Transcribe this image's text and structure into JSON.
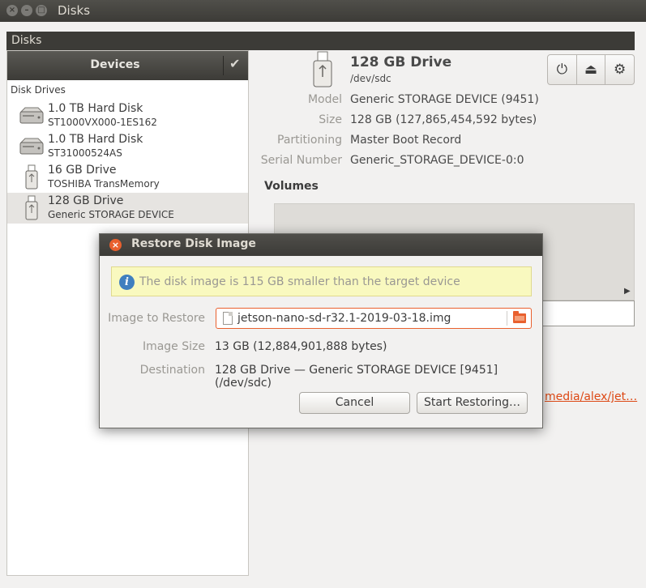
{
  "window": {
    "title": "Disks"
  },
  "appbar": {
    "title": "Disks"
  },
  "sidebar": {
    "header": "Devices",
    "section": "Disk Drives",
    "items": [
      {
        "name": "1.0 TB Hard Disk",
        "sub": "ST1000VX000-1ES162",
        "icon": "hard-disk-icon"
      },
      {
        "name": "1.0 TB Hard Disk",
        "sub": "ST31000524AS",
        "icon": "hard-disk-icon"
      },
      {
        "name": "16 GB Drive",
        "sub": "TOSHIBA TransMemory",
        "icon": "usb-drive-icon"
      },
      {
        "name": "128 GB Drive",
        "sub": "Generic STORAGE DEVICE",
        "icon": "usb-drive-icon",
        "selected": true
      }
    ]
  },
  "detail": {
    "name": "128 GB Drive",
    "path": "/dev/sdc",
    "props": [
      {
        "label": "Model",
        "value": "Generic STORAGE DEVICE (9451)"
      },
      {
        "label": "Size",
        "value": "128 GB (127,865,454,592 bytes)"
      },
      {
        "label": "Partitioning",
        "value": "Master Boot Record"
      },
      {
        "label": "Serial Number",
        "value": "Generic_STORAGE_DEVICE-0:0"
      }
    ],
    "volumes_title": "Volumes",
    "partial_link": "media/alex/jet…"
  },
  "dialog": {
    "title": "Restore Disk Image",
    "info": "The disk image is 115 GB smaller than the target device",
    "image_label": "Image to Restore",
    "image_file": "jetson-nano-sd-r32.1-2019-03-18.img",
    "size_label": "Image Size",
    "size_value": "13 GB (12,884,901,888 bytes)",
    "dest_label": "Destination",
    "dest_value": "128 GB Drive — Generic STORAGE DEVICE [9451] (/dev/sdc)",
    "cancel": "Cancel",
    "start": "Start Restoring…"
  },
  "colors": {
    "accent": "#e9602e",
    "info_bg": "#f9f9bf",
    "titlebar": "#3c3b37"
  }
}
